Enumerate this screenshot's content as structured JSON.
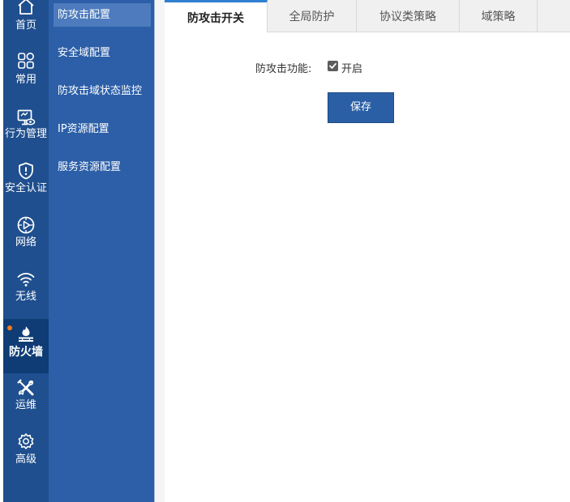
{
  "nav": {
    "items": [
      {
        "label": "首页",
        "icon": "home-icon"
      },
      {
        "label": "常用",
        "icon": "grid-icon"
      },
      {
        "label": "行为管理",
        "icon": "monitor-eye-icon"
      },
      {
        "label": "安全认证",
        "icon": "shield-icon"
      },
      {
        "label": "网络",
        "icon": "network-icon"
      },
      {
        "label": "无线",
        "icon": "wifi-icon"
      },
      {
        "label": "防火墙",
        "icon": "firewall-icon",
        "active": true
      },
      {
        "label": "运维",
        "icon": "tools-icon"
      },
      {
        "label": "高级",
        "icon": "gear-icon"
      }
    ],
    "active_indicator_color": "#ff7a1a"
  },
  "submenu": {
    "items": [
      {
        "label": "防攻击配置",
        "active": true
      },
      {
        "label": "安全域配置"
      },
      {
        "label": "防攻击域状态监控"
      },
      {
        "label": "IP资源配置"
      },
      {
        "label": "服务资源配置"
      }
    ]
  },
  "tabs": [
    {
      "label": "防攻击开关",
      "active": true
    },
    {
      "label": "全局防护"
    },
    {
      "label": "协议类策略"
    },
    {
      "label": "域策略"
    }
  ],
  "form": {
    "field_label": "防攻击功能:",
    "checkbox_checked": true,
    "checkbox_label": "开启",
    "save_label": "保存"
  },
  "colors": {
    "rail_bg": "#1f4f8e",
    "rail_active_bg": "#0f3c75",
    "submenu_bg": "#2c5fa8",
    "submenu_active_bg": "#4d7bbd",
    "tab_active_border": "#2f7fd0",
    "button_bg": "#2a5fa6"
  }
}
